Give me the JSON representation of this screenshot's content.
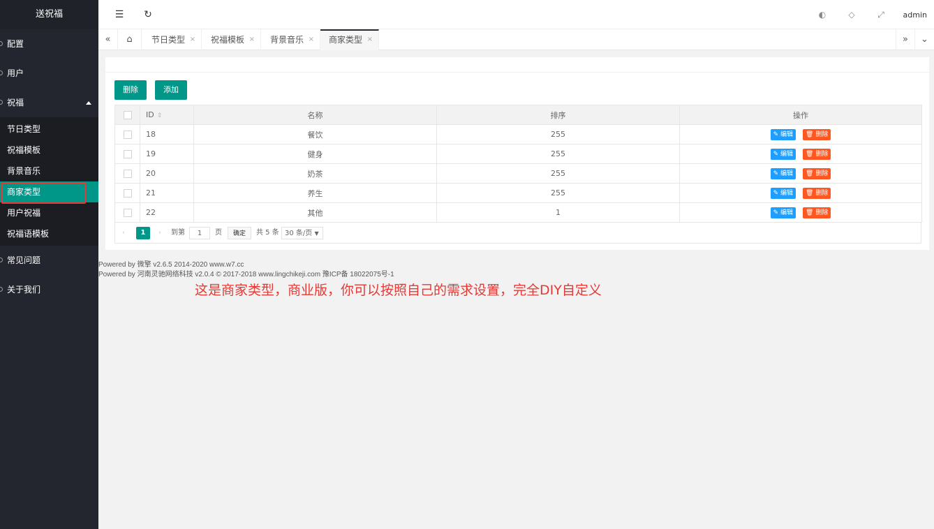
{
  "sidebar": {
    "logo": "送祝福",
    "items": [
      {
        "label": "配置"
      },
      {
        "label": "用户"
      },
      {
        "label": "祝福"
      }
    ],
    "children": [
      {
        "label": "节日类型"
      },
      {
        "label": "祝福模板"
      },
      {
        "label": "背景音乐"
      },
      {
        "label": "商家类型"
      },
      {
        "label": "用户祝福"
      },
      {
        "label": "祝福语模板"
      }
    ],
    "bottom_items": [
      {
        "label": "常见问题"
      },
      {
        "label": "关于我们"
      }
    ]
  },
  "header": {
    "user": "admin",
    "icons": [
      "menu-fold-icon",
      "refresh-icon",
      "theme-icon",
      "tag-icon",
      "fullscreen-icon"
    ]
  },
  "tabs": {
    "items": [
      {
        "label": "节日类型"
      },
      {
        "label": "祝福模板"
      },
      {
        "label": "背景音乐"
      },
      {
        "label": "商家类型"
      }
    ],
    "close_glyph": "×"
  },
  "toolbar": {
    "delete_label": "删除",
    "add_label": "添加"
  },
  "table": {
    "columns": [
      "ID",
      "名称",
      "排序",
      "操作"
    ],
    "rows": [
      {
        "id": "18",
        "name": "餐饮",
        "sort": "255"
      },
      {
        "id": "19",
        "name": "健身",
        "sort": "255"
      },
      {
        "id": "20",
        "name": "奶茶",
        "sort": "255"
      },
      {
        "id": "21",
        "name": "养生",
        "sort": "255"
      },
      {
        "id": "22",
        "name": "其他",
        "sort": "1"
      }
    ],
    "edit_label": "✎ 编辑",
    "delete_label": "🗑 删除"
  },
  "pager": {
    "current": "1",
    "goto_label": "到第",
    "page_value": "1",
    "page_unit": "页",
    "confirm_label": "确定",
    "total": "共 5 条",
    "page_size": "30 条/页"
  },
  "footer": {
    "line1": "Powered by 微擎 v2.6.5 2014-2020 www.w7.cc",
    "line2": "Powered by 河南灵驰网络科技 v2.0.4 © 2017-2018 www.lingchikeji.com 豫ICP备 18022075号-1"
  },
  "annotation": "这是商家类型，商业版，你可以按照自己的需求设置，完全DIY自定义",
  "colors": {
    "sidebar_bg": "#23262e",
    "accent": "#009688",
    "edit": "#1e9fff",
    "delete": "#ff5722",
    "annotation": "#e53935"
  }
}
